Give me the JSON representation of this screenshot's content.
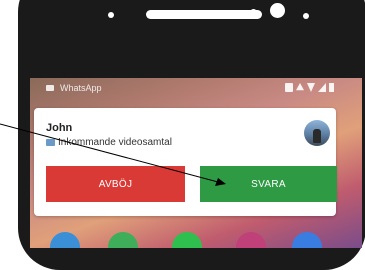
{
  "status_bar": {
    "app_name": "WhatsApp"
  },
  "notification": {
    "caller_name": "John",
    "subtitle": "Inkommande videosamtal",
    "decline_label": "AVBÖJ",
    "answer_label": "SVARA"
  },
  "colors": {
    "decline": "#d93a36",
    "answer": "#2f9a44",
    "phone_body": "#1a1a1a"
  },
  "dock_apps": [
    "telegram-icon",
    "green-app-icon",
    "whatsapp-icon",
    "instagram-icon",
    "messenger-icon"
  ]
}
